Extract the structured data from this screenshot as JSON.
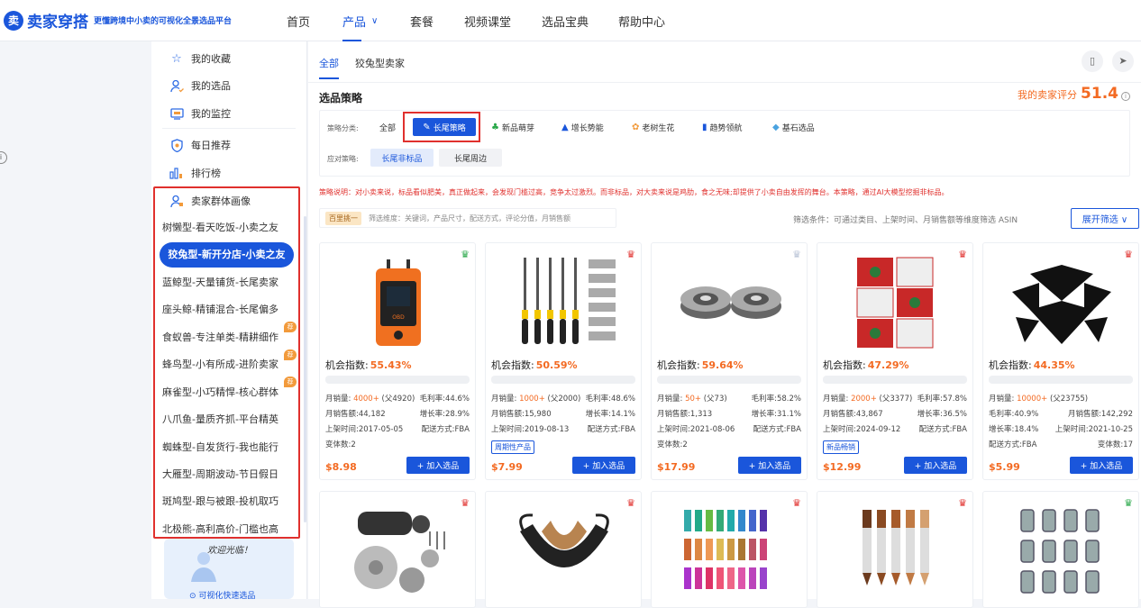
{
  "header": {
    "logo_badge": "卖",
    "logo_title": "卖家穿搭",
    "logo_slogan": "更懂跨境中小卖的可视化全景选品平台",
    "nav": [
      "首页",
      "产品",
      "套餐",
      "视频课堂",
      "选品宝典",
      "帮助中心"
    ],
    "active_nav": "产品"
  },
  "sidebar": {
    "items": [
      {
        "label": "我的收藏",
        "icon": "star-icon"
      },
      {
        "label": "我的选品",
        "icon": "user-select-icon"
      },
      {
        "label": "我的监控",
        "icon": "monitor-icon"
      },
      {
        "label": "每日推荐",
        "icon": "shield-icon"
      },
      {
        "label": "排行榜",
        "icon": "bar-chart-icon"
      }
    ],
    "persona_header": "卖家群体画像",
    "personas": [
      "树懒型-看天吃饭-小卖之友",
      "狡兔型-新开分店-小卖之友",
      "蓝鲸型-天量铺货-长尾卖家",
      "座头鲸-精铺混合-长尾偏多",
      "食蚁兽-专注单类-精耕细作",
      "蜂鸟型-小有所成-进阶卖家",
      "麻雀型-小巧精悍-核心群体",
      "八爪鱼-量质齐抓-平台精英",
      "蜘蛛型-自发货行-我也能行",
      "大雁型-周期波动-节日假日",
      "斑鸠型-跟与被跟-投机取巧",
      "北极熊-高利高价-门槛也高"
    ],
    "active_persona": "狡兔型-新开分店-小卖之友",
    "hot_label": "荐",
    "promo_text": "欢迎光临！",
    "promo_link": "可视化快速选品"
  },
  "main": {
    "tabs": [
      "全部",
      "狡兔型卖家"
    ],
    "active_tab": "全部",
    "section_title": "选品策略",
    "score_label": "我的卖家评分",
    "score_value": "51.4",
    "strategy_label": "策略分类:",
    "strategy_all": "全部",
    "strategies": [
      {
        "label": "长尾策略",
        "icon": "feather-icon",
        "active": true
      },
      {
        "label": "新品萌芽",
        "icon": "sprout-icon"
      },
      {
        "label": "增长势能",
        "icon": "rocket-icon"
      },
      {
        "label": "老树生花",
        "icon": "flower-tree-icon"
      },
      {
        "label": "趋势领航",
        "icon": "trend-icon"
      },
      {
        "label": "基石选品",
        "icon": "diamond-icon"
      }
    ],
    "response_label": "应对策略:",
    "responses": [
      "长尾非标品",
      "长尾周边"
    ],
    "active_response": "长尾非标品",
    "note": "策略说明：对小卖来说，标品看似肥美，真正做起来，会发现门槛过高，竞争太过激烈。而非标品，对大卖来说是鸡肋，食之无味;却提供了小卖自由发挥的舞台。本策略，通过AI大模型挖掘非标品。",
    "dim_badge": "百里挑一",
    "dim_text": "筛选维度：关键词，产品尺寸，配送方式，评论分值，月销售额",
    "filter_text": "筛选条件：可通过类目、上架时间、月销售额等维度筛选 ASIN",
    "expand_label": "展开筛选 ∨"
  },
  "products": [
    {
      "crown_color": "#2aa84a",
      "index_label": "机会指数:",
      "index": "55.43%",
      "m1a": "月销量: ",
      "m1b": "4000+",
      "m1c": " (父4920)",
      "m2": "毛利率:44.6%",
      "m3": "月销售额:44,182",
      "m4": "增长率:28.9%",
      "m5": "上架时间:2017-05-05",
      "m6": "配送方式:FBA",
      "m7": "变体数:2",
      "tag": "",
      "price": "$8.98",
      "add": "+ 加入选品",
      "image": "obd-tool"
    },
    {
      "crown_color": "#e0302d",
      "index_label": "机会指数:",
      "index": "50.59%",
      "m1a": "月销量: ",
      "m1b": "1000+",
      "m1c": " (父2000)",
      "m2": "毛利率:48.6%",
      "m3": "月销售额:15,980",
      "m4": "增长率:14.1%",
      "m5": "上架时间:2019-08-13",
      "m6": "配送方式:FBA",
      "m7": "",
      "tag": "周期性产品",
      "price": "$7.99",
      "add": "+ 加入选品",
      "image": "file-set"
    },
    {
      "crown_color": "#b9c3d6",
      "index_label": "机会指数:",
      "index": "59.64%",
      "m1a": "月销量: ",
      "m1b": "50+",
      "m1c": " (父73)",
      "m2": "毛利率:58.2%",
      "m3": "月销售额:1,313",
      "m4": "增长率:31.1%",
      "m5": "上架时间:2021-08-06",
      "m6": "配送方式:FBA",
      "m7": "变体数:2",
      "tag": "",
      "price": "$17.99",
      "add": "+ 加入选品",
      "image": "bearings"
    },
    {
      "crown_color": "#e0302d",
      "index_label": "机会指数:",
      "index": "47.29%",
      "m1a": "月销量: ",
      "m1b": "2000+",
      "m1c": " (父3377)",
      "m2": "毛利率:57.8%",
      "m3": "月销售额:43,867",
      "m4": "增长率:36.5%",
      "m5": "上架时间:2024-09-12",
      "m6": "配送方式:FBA",
      "m7": "",
      "tag": "新品畅销",
      "price": "$12.99",
      "add": "+ 加入选品",
      "image": "pillows"
    },
    {
      "crown_color": "#e0302d",
      "index_label": "机会指数:",
      "index": "44.35%",
      "m1a": "月销量: ",
      "m1b": "10000+",
      "m1c": " (父23755)",
      "m2": "",
      "m3": "毛利率:40.9%",
      "m4": "月销售额:142,292",
      "m5": "增长率:18.4%",
      "m6": "上架时间:2021-10-25",
      "m7": "配送方式:FBA",
      "m8": "变体数:17",
      "tag": "",
      "price": "$5.99",
      "add": "+ 加入选品",
      "image": "puffs"
    },
    {
      "crown_color": "#e0302d",
      "image": "sander-kit"
    },
    {
      "crown_color": "#e0302d",
      "image": "log-bag"
    },
    {
      "crown_color": "#e0302d",
      "image": "tassels"
    },
    {
      "crown_color": "#e0302d",
      "image": "markers"
    },
    {
      "crown_color": "#2aa84a",
      "image": "linear-bearings"
    }
  ]
}
